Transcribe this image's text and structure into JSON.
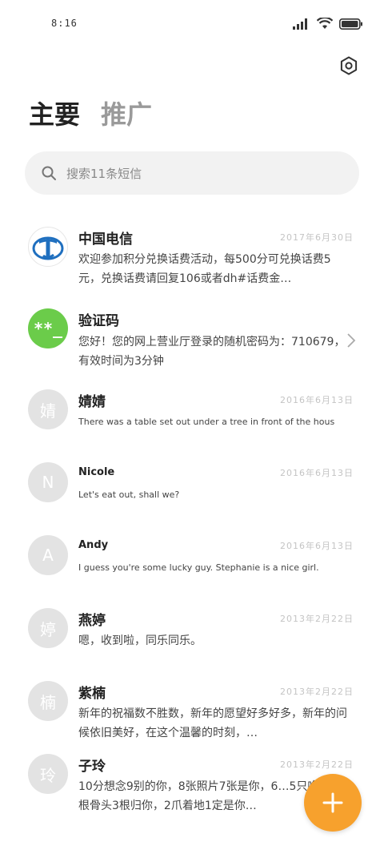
{
  "status_bar": {
    "time": "8:16"
  },
  "tabs": [
    {
      "label": "主要",
      "active": true
    },
    {
      "label": "推广",
      "active": false
    }
  ],
  "search": {
    "placeholder": "搜索11条短信"
  },
  "colors": {
    "accent": "#f7a12d",
    "green_avatar": "#6bcc4a",
    "telecom_blue": "#1f6fbf"
  },
  "messages": [
    {
      "avatar_type": "logo",
      "avatar_icon": "china-telecom-logo",
      "sender": "中国电信",
      "date": "2017年6月30日",
      "preview": "欢迎参加积分兑换话费活动，每500分可兑换话费5元，兑换话费请回复106或者dh#话费金…"
    },
    {
      "avatar_type": "text",
      "avatar_text": "**_",
      "sender": "验证码",
      "date": "",
      "preview": "您好！您的网上营业厅登录的随机密码为：710679，有效时间为3分钟"
    },
    {
      "avatar_type": "text",
      "avatar_text": "婧",
      "sender": "婧婧",
      "date": "2016年6月13日",
      "preview": "There was a table set out under a tree in front of the hous"
    },
    {
      "avatar_type": "text",
      "avatar_text": "N",
      "sender": "Nicole",
      "date": "2016年6月13日",
      "preview": "Let's eat out, shall we?"
    },
    {
      "avatar_type": "text",
      "avatar_text": "A",
      "sender": "Andy",
      "date": "2016年6月13日",
      "preview": "I guess you're some lucky guy. Stephanie is a nice girl."
    },
    {
      "avatar_type": "text",
      "avatar_text": "婷",
      "sender": "燕婷",
      "date": "2013年2月22日",
      "preview": "嗯，收到啦，同乐同乐。"
    },
    {
      "avatar_type": "text",
      "avatar_text": "楠",
      "sender": "紫楠",
      "date": "2013年2月22日",
      "preview": "新年的祝福数不胜数，新年的愿望好多好多，新年的问候依旧美好，在这个温馨的时刻，…"
    },
    {
      "avatar_type": "text",
      "avatar_text": "玲",
      "sender": "子玲",
      "date": "2013年2月22日",
      "preview": "10分想念9别的你，8张照片7张是你，6…5只唤你，4根骨头3根归你，2爪着地1定是你…"
    }
  ]
}
